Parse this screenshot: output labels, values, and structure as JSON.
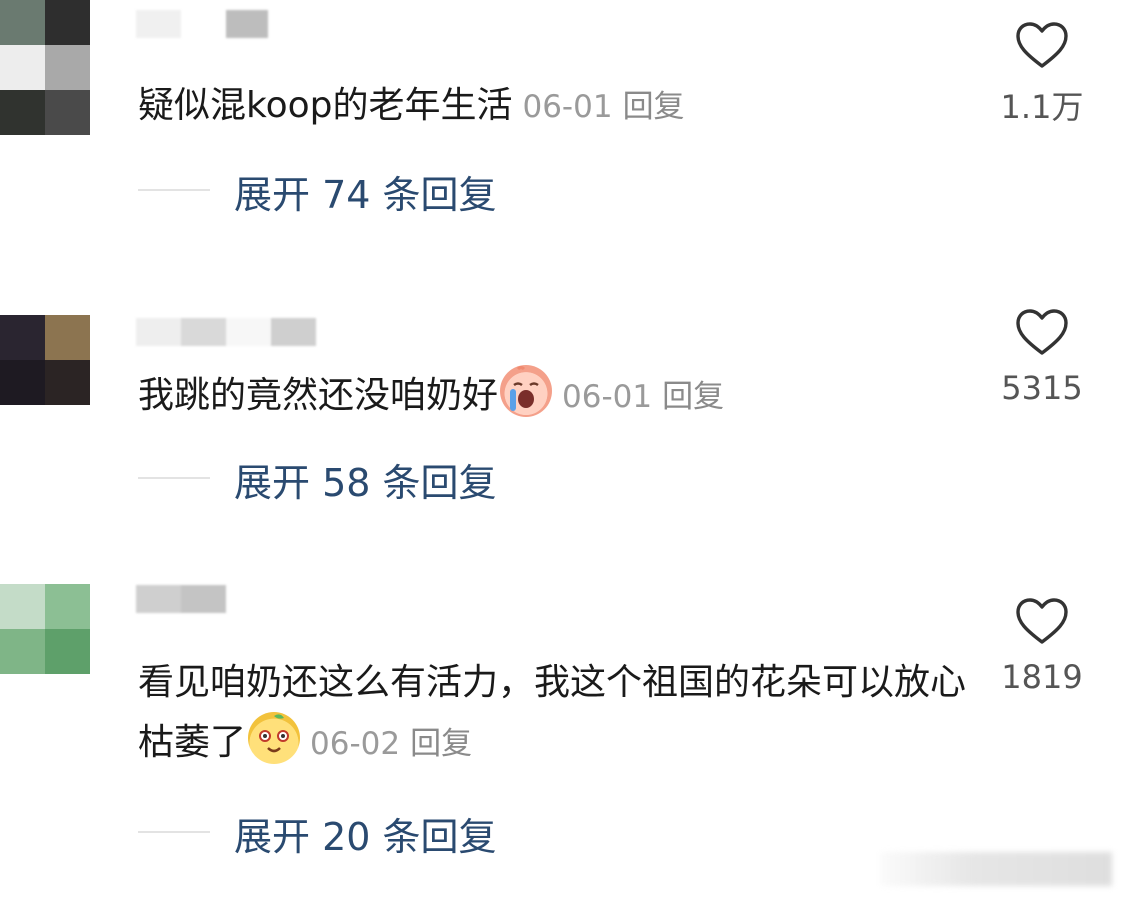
{
  "comments": [
    {
      "text": "疑似混koop的老年生活",
      "date": "06-01",
      "reply_label": "回复",
      "likes": "1.1万",
      "expand_label": "展开 74 条回复",
      "avatar_colors": [
        "#5d6b63",
        "#2c2c2c",
        "#ececec",
        "#b0b0b0"
      ]
    },
    {
      "text": "我跳的竟然还没咱奶好",
      "date": "06-01",
      "reply_label": "回复",
      "likes": "5315",
      "expand_label": "展开 58 条回复",
      "emoji": "crying-emoji",
      "avatar_colors": [
        "#2a2530",
        "#8c7450",
        "#1e1a22",
        "#2b2424"
      ]
    },
    {
      "text": "看见咱奶还这么有活力，我这个祖国的花朵可以放心枯萎了",
      "date": "06-02",
      "reply_label": "回复",
      "likes": "1819",
      "expand_label": "展开 20 条回复",
      "emoji": "mango-emoji",
      "avatar_colors": [
        "#c4dcc8",
        "#8cbf94",
        "#7fb587",
        "#5ea06a"
      ]
    }
  ],
  "colors": {
    "text": "#1a1a1a",
    "meta": "#9a9a9a",
    "expand": "#2a4a70",
    "divider": "#e3e3e3"
  },
  "icons": {
    "like": "heart-outline-icon"
  }
}
